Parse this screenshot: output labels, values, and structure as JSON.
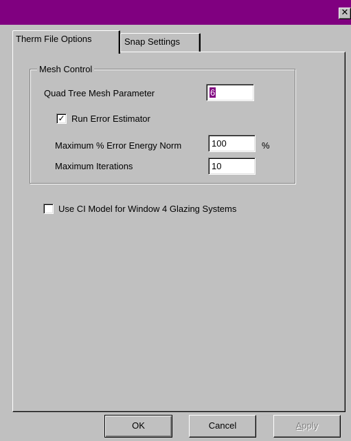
{
  "window": {
    "close_glyph": "✕"
  },
  "tabs": [
    {
      "label": "Therm File Options",
      "active": true
    },
    {
      "label": "Snap Settings",
      "active": false
    }
  ],
  "mesh_control": {
    "group_label": "Mesh Control",
    "quad_tree_label": "Quad Tree Mesh Parameter",
    "quad_tree_value": "6",
    "run_error_label": "Run Error Estimator",
    "run_error_checked": true,
    "max_error_label": "Maximum % Error Energy Norm",
    "max_error_value": "100",
    "max_error_unit": "%",
    "max_iter_label": "Maximum Iterations",
    "max_iter_value": "10"
  },
  "ci_model": {
    "label": "Use CI Model for Window 4 Glazing Systems",
    "checked": false
  },
  "buttons": {
    "ok": "OK",
    "cancel": "Cancel",
    "apply_first": "A",
    "apply_rest": "pply"
  },
  "colors": {
    "titlebar": "#800080",
    "face": "#c0c0c0",
    "selection": "#800080"
  }
}
